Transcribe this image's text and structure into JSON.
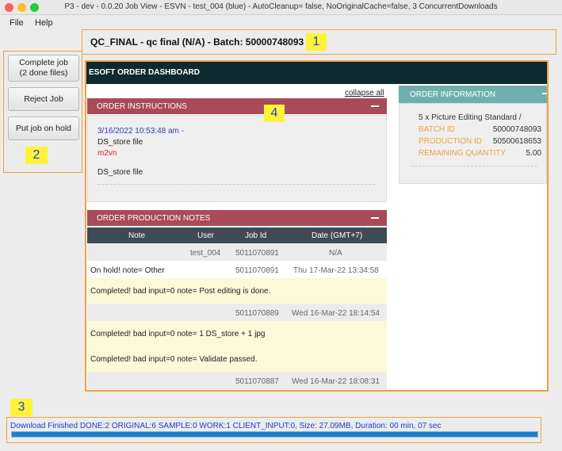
{
  "window": {
    "title": "P3 - dev - 0.0.20 Job View  - ESVN - test_004 (blue) - AutoCleanup= false, NoOriginalCache=false, 3 ConcurrentDownloads"
  },
  "menu": [
    "File",
    "Help"
  ],
  "header": {
    "batch_title": "QC_FINAL - qc final (N/A) - Batch: 50000748093"
  },
  "annotations": [
    "1",
    "2",
    "3",
    "4"
  ],
  "actions": {
    "complete_job": "Complete job\n(2 done files)",
    "reject_job": "Reject Job",
    "hold_job": "Put job on hold"
  },
  "dashboard": {
    "title": "ESOFT ORDER DASHBOARD",
    "collapse_all": "collapse all",
    "instructions": {
      "title": "ORDER INSTRUCTIONS",
      "timestamp": "3/16/2022 10:53:48 am -",
      "line1": "DS_store file",
      "line2": "m2vn",
      "line3": "DS_store file"
    },
    "order_info": {
      "title": "ORDER INFORMATION",
      "product": "5 x Picture Editing Standard /",
      "rows": [
        {
          "label": "BATCH ID",
          "value": "50000748093"
        },
        {
          "label": "PRODUCTION ID",
          "value": "50500618653"
        },
        {
          "label": "REMAINING QUANTITY",
          "value": "5.00"
        }
      ]
    },
    "production_notes": {
      "title": "ORDER PRODUCTION NOTES",
      "columns": [
        "Note",
        "User",
        "Job Id",
        "Date (GMT+7)"
      ],
      "rows": [
        {
          "note": "",
          "user": "test_004",
          "job": "5011070891",
          "date": "N/A"
        },
        {
          "note": "On hold! note= Other",
          "user": "",
          "job": "5011070891",
          "date": "Thu 17-Mar-22 13:34:58"
        },
        {
          "note": "Completed! bad input=0 note= Post editing is done.",
          "user": "",
          "job": "",
          "date": ""
        },
        {
          "note": "",
          "user": "",
          "job": "5011070889",
          "date": "Wed 16-Mar-22 18:14:54"
        },
        {
          "note": "Completed! bad input=0 note= 1 DS_store + 1 jpg",
          "user": "",
          "job": "",
          "date": ""
        },
        {
          "note": "Completed! bad input=0 note= Validate passed.",
          "user": "",
          "job": "",
          "date": ""
        },
        {
          "note": "",
          "user": "",
          "job": "5011070887",
          "date": "Wed 16-Mar-22 18:08:31"
        }
      ]
    }
  },
  "status": {
    "text": "Download Finished DONE:2 ORIGINAL:6 SAMPLE:0 WORK:1 CLIENT_INPUT:0, Size: 27.09MB, Duration: 00 min, 07 sec",
    "progress": 1.0
  },
  "colors": {
    "accent_orange": "#f0a040",
    "dashboard_header": "#0e2a30",
    "panel_red": "#a84a58",
    "panel_teal": "#6fb0ae",
    "label_orange": "#f0a040",
    "link_blue": "#2a3fbf",
    "note_red": "#e02020"
  }
}
